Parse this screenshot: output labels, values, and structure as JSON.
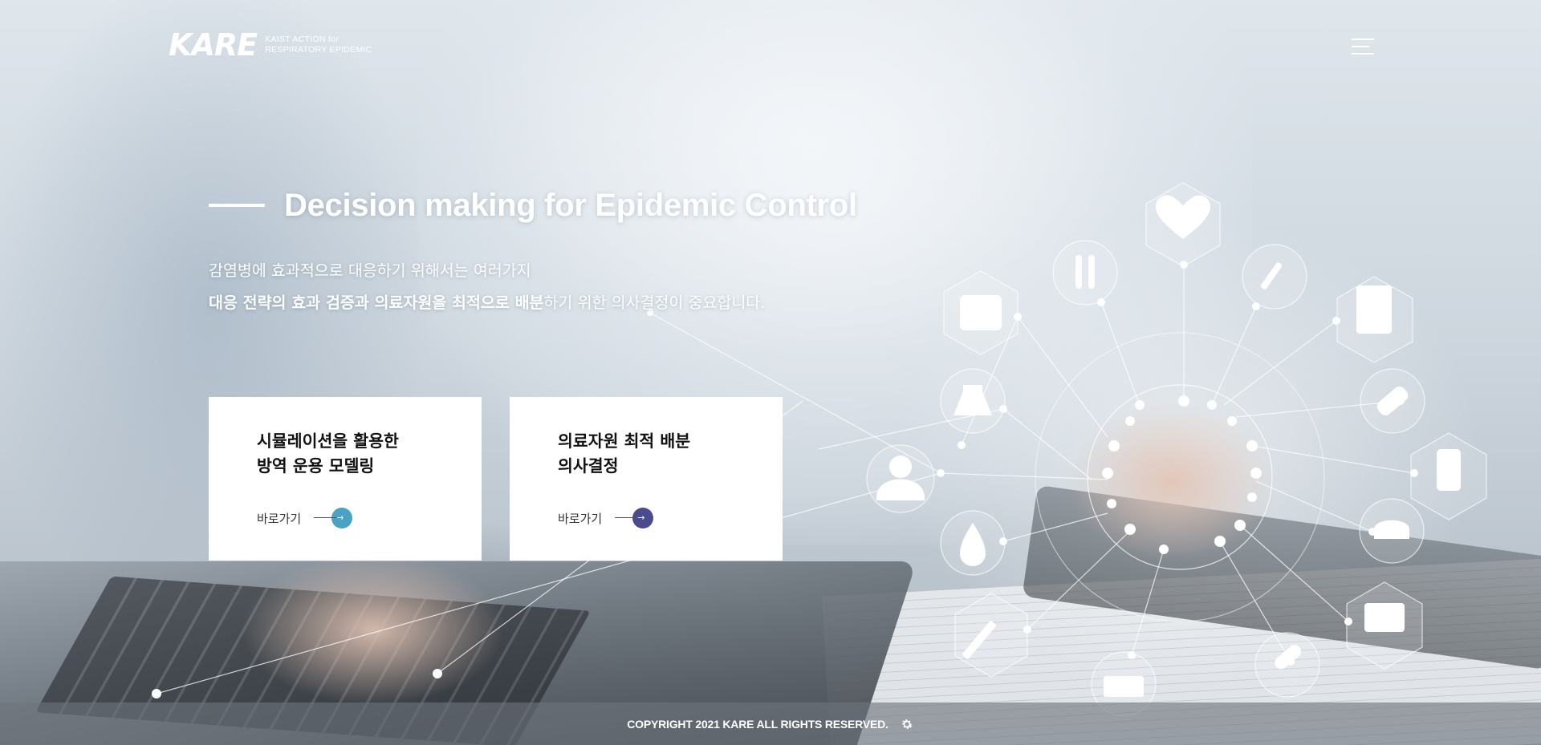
{
  "header": {
    "logo_text": "KARE",
    "logo_sub_line1": "KAIST ACTION for",
    "logo_sub_line2": "RESPIRATORY EPIDEMIC",
    "menu_icon": "hamburger-menu-icon"
  },
  "hero": {
    "title": "Decision making for Epidemic Control",
    "desc_line1": "감염병에 효과적으로 대응하기 위해서는 여러가지",
    "desc_line2_bold": "대응 전략의 효과 검증과 의료자원을 최적으로 배분",
    "desc_line2_rest": "하기 위한 의사결정이 중요합니다."
  },
  "cards": [
    {
      "title_line1": "시뮬레이션을 활용한",
      "title_line2": "방역 운용 모델링",
      "link_label": "바로가기",
      "accent": "#4aa3c4"
    },
    {
      "title_line1": "의료자원 최적 배분",
      "title_line2": "의사결정",
      "link_label": "바로가기",
      "accent": "#4a4a8e"
    }
  ],
  "background_icons": [
    "heart-rate-icon",
    "test-tubes-icon",
    "dropper-icon",
    "first-aid-kit-icon",
    "clipboard-icon",
    "flask-icon",
    "pills-icon",
    "doctor-icon",
    "iv-bag-icon",
    "blood-drop-icon",
    "nurse-cap-icon",
    "syringe-icon",
    "monitor-icon",
    "ambulance-icon",
    "capsule-icon"
  ],
  "footer": {
    "copyright": "COPYRIGHT 2021 KARE ALL RIGHTS RESERVED.",
    "settings_icon": "gear-icon"
  }
}
